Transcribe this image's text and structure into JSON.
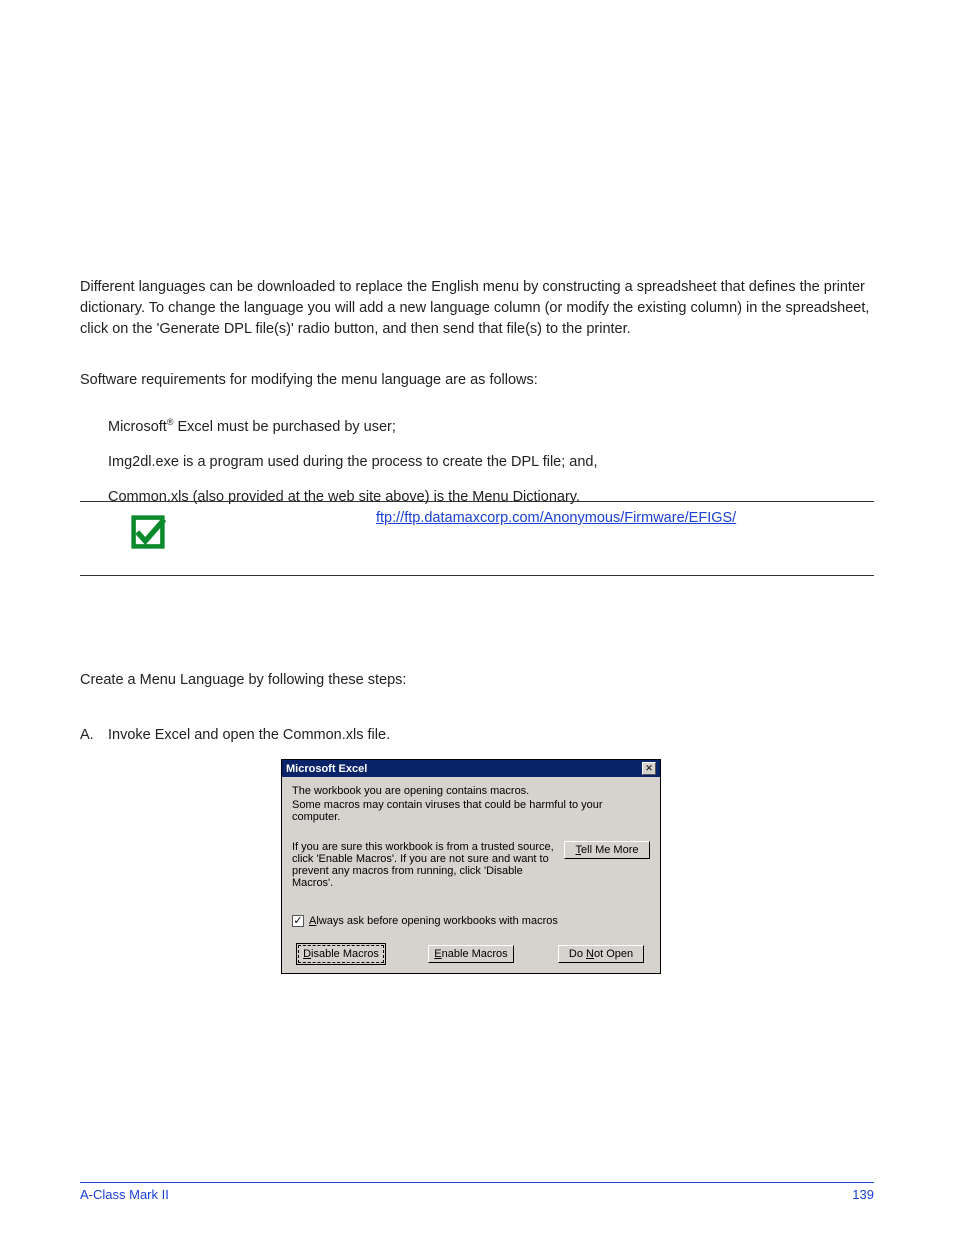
{
  "intro": "Different languages can be downloaded to replace the English menu by constructing a spreadsheet that defines the printer dictionary. To change the language you will add a new language column (or modify the existing column) in the spreadsheet, click on the 'Generate DPL file(s)' radio button, and then send that file(s) to the printer.",
  "requirements_intro": "Software requirements for modifying the menu language are as follows:",
  "req_items": {
    "excel_pre": "Microsoft",
    "excel_sup": "®",
    "excel_post": " Excel must be purchased by user;",
    "img2dl": "Img2dl.exe is a program used during the process to create the DPL file; and,",
    "common": "Common.xls (also provided at the web site above) is the Menu Dictionary."
  },
  "callout_link": " ftp://ftp.datamaxcorp.com/Anonymous/Firmware/EFIGS/",
  "create_intro": "Create a Menu Language by following these steps:",
  "step": {
    "letter": "A.",
    "text": "Invoke Excel and open the Common.xls file."
  },
  "dialog": {
    "title": "Microsoft Excel",
    "msg1": "The workbook you are opening contains macros.",
    "msg2": "Some macros may contain viruses that could be harmful to your computer.",
    "trusted": "If you are sure this workbook is from a trusted source, click 'Enable Macros'. If you are not sure and want to prevent any macros from running, click 'Disable Macros'.",
    "tell_me_more": "Tell Me More",
    "always_ask_pre": "A",
    "always_ask_rest": "lways ask before opening workbooks with macros",
    "disable_pre": "D",
    "disable_rest": "isable Macros",
    "enable_pre": "E",
    "enable_rest": "nable Macros",
    "dont_open_pre": "Do ",
    "dont_open_u": "N",
    "dont_open_rest": "ot Open"
  },
  "footer": {
    "left": "A-Class Mark II",
    "right": "139"
  }
}
